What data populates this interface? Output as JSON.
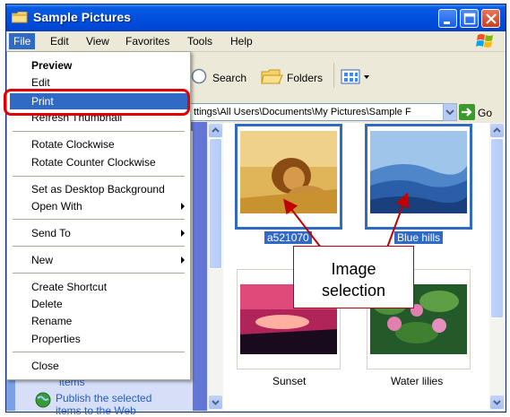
{
  "window": {
    "title": "Sample Pictures",
    "colors": {
      "title_bar": "#0050e0",
      "selection": "#316ac5",
      "callout_border": "#c00000",
      "highlight_ring": "#e00000"
    }
  },
  "menubar": {
    "items": [
      "File",
      "Edit",
      "View",
      "Favorites",
      "Tools",
      "Help"
    ]
  },
  "toolbar": {
    "search_label": "Search",
    "folders_label": "Folders"
  },
  "address": {
    "value": "ttings\\All Users\\Documents\\My Pictures\\Sample F",
    "go_label": "Go"
  },
  "file_menu": {
    "items": [
      "Preview",
      "Edit",
      "Print",
      "Refresh Thumbnail",
      "Rotate Clockwise",
      "Rotate Counter Clockwise",
      "Set as Desktop Background",
      "Open With",
      "Send To",
      "New",
      "Create Shortcut",
      "Delete",
      "Rename",
      "Properties",
      "Close"
    ]
  },
  "tasks": {
    "items_fragment": "items",
    "publish": "Publish the selected items to the Web"
  },
  "thumbnails": [
    {
      "caption": "a521070",
      "selected": true,
      "icon": "lion-photo"
    },
    {
      "caption": "Blue hills",
      "selected": true,
      "icon": "blue-hills-photo"
    },
    {
      "caption": "Sunset",
      "selected": false,
      "icon": "sunset-photo"
    },
    {
      "caption": "Water lilies",
      "selected": false,
      "icon": "water-lilies-photo"
    }
  ],
  "annotation": {
    "line1": "Image",
    "line2": "selection"
  }
}
